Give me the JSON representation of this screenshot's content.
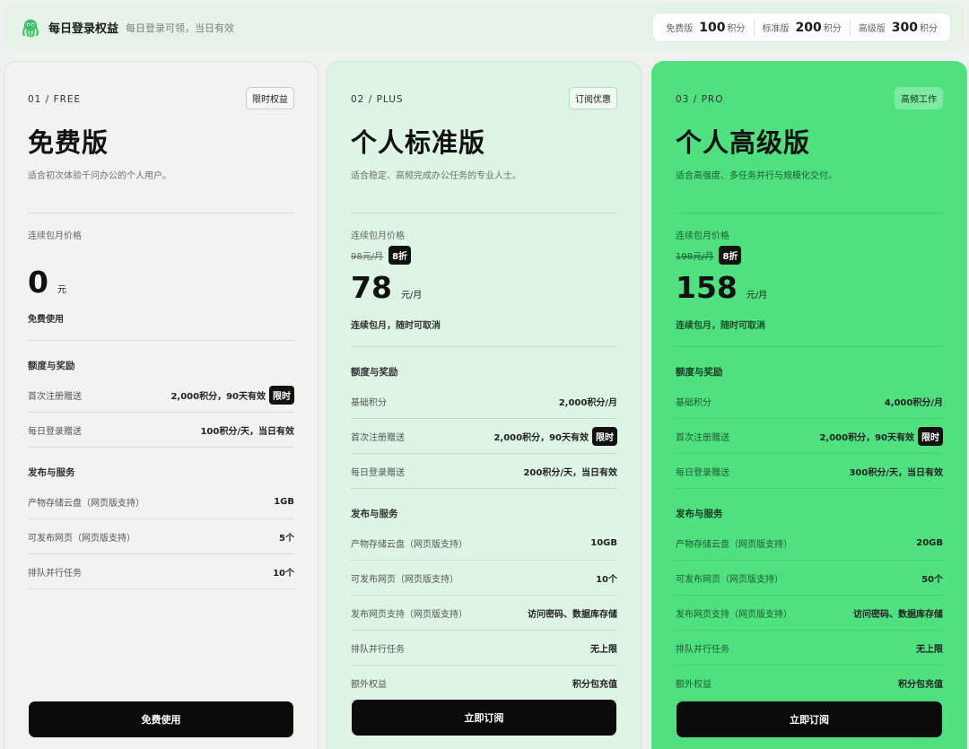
{
  "header": {
    "brand": "每日登录权益",
    "subtitle": "每日登录可领，当日有效",
    "points": [
      {
        "name": "免费版",
        "value": "100",
        "unit": "积分"
      },
      {
        "name": "标准版",
        "value": "200",
        "unit": "积分"
      },
      {
        "name": "高级版",
        "value": "300",
        "unit": "积分"
      }
    ]
  },
  "plans": [
    {
      "code": "01 / FREE",
      "tag": "限时权益",
      "title": "免费版",
      "subtitle": "适合初次体验千问办公的个人用户。",
      "price_label": "连续包月价格",
      "price": "0",
      "unit": "元",
      "note": "免费使用",
      "sections": [
        {
          "title": "额度与奖励",
          "rows": [
            {
              "k": "首次注册赠送",
              "v": "2,000积分，90天有效",
              "badge": "限时"
            },
            {
              "k": "每日登录赠送",
              "v": "100积分/天，当日有效"
            }
          ]
        },
        {
          "title": "发布与服务",
          "rows": [
            {
              "k": "产物存储云盘（网页版支持）",
              "v": "1GB"
            },
            {
              "k": "可发布网页（网页版支持）",
              "v": "5个"
            },
            {
              "k": "排队并行任务",
              "v": "10个"
            }
          ]
        }
      ],
      "button": "免费使用"
    },
    {
      "code": "02 / PLUS",
      "tag": "订阅优惠",
      "title": "个人标准版",
      "subtitle": "适合稳定、高频完成办公任务的专业人士。",
      "price_label": "连续包月价格",
      "orig": "98元/月",
      "discount": "8折",
      "price": "78",
      "unit": "元/月",
      "note": "连续包月，随时可取消",
      "sections": [
        {
          "title": "额度与奖励",
          "rows": [
            {
              "k": "基础积分",
              "v": "2,000积分/月"
            },
            {
              "k": "首次注册赠送",
              "v": "2,000积分，90天有效",
              "badge": "限时"
            },
            {
              "k": "每日登录赠送",
              "v": "200积分/天，当日有效"
            }
          ]
        },
        {
          "title": "发布与服务",
          "rows": [
            {
              "k": "产物存储云盘（网页版支持）",
              "v": "10GB"
            },
            {
              "k": "可发布网页（网页版支持）",
              "v": "10个"
            },
            {
              "k": "发布网页支持（网页版支持）",
              "v": "访问密码、数据库存储"
            },
            {
              "k": "排队并行任务",
              "v": "无上限"
            },
            {
              "k": "额外权益",
              "v": "积分包充值"
            }
          ]
        }
      ],
      "button": "立即订阅"
    },
    {
      "code": "03 / PRO",
      "tag": "高频工作",
      "title": "个人高级版",
      "subtitle": "适合高强度、多任务并行与规模化交付。",
      "price_label": "连续包月价格",
      "orig": "198元/月",
      "discount": "8折",
      "price": "158",
      "unit": "元/月",
      "note": "连续包月，随时可取消",
      "sections": [
        {
          "title": "额度与奖励",
          "rows": [
            {
              "k": "基础积分",
              "v": "4,000积分/月"
            },
            {
              "k": "首次注册赠送",
              "v": "2,000积分，90天有效",
              "badge": "限时"
            },
            {
              "k": "每日登录赠送",
              "v": "300积分/天，当日有效"
            }
          ]
        },
        {
          "title": "发布与服务",
          "rows": [
            {
              "k": "产物存储云盘（网页版支持）",
              "v": "20GB"
            },
            {
              "k": "可发布网页（网页版支持）",
              "v": "50个"
            },
            {
              "k": "发布网页支持（网页版支持）",
              "v": "访问密码、数据库存储"
            },
            {
              "k": "排队并行任务",
              "v": "无上限"
            },
            {
              "k": "额外权益",
              "v": "积分包充值"
            }
          ]
        }
      ],
      "button": "立即订阅"
    }
  ]
}
